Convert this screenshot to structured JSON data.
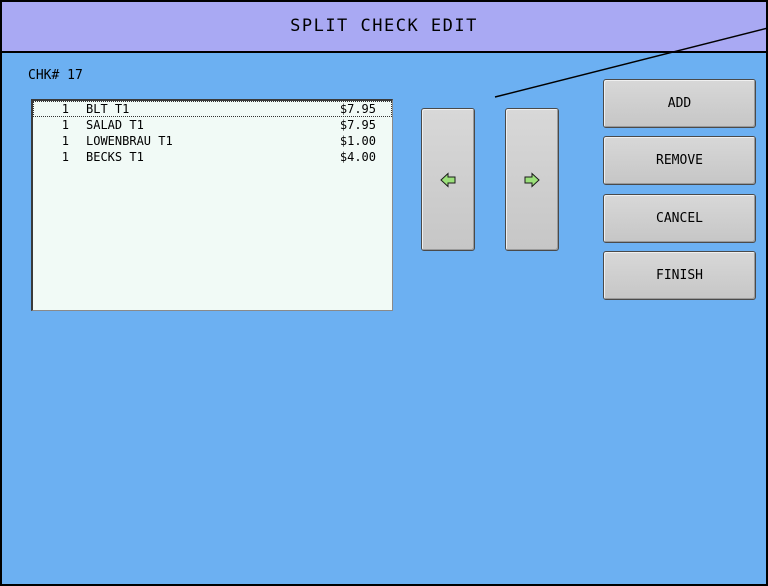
{
  "title": "SPLIT CHECK EDIT",
  "check_label": "CHK# 17",
  "items": [
    {
      "qty": "1",
      "name": "BLT T1",
      "price": "$7.95",
      "selected": true
    },
    {
      "qty": "1",
      "name": "SALAD T1",
      "price": "$7.95",
      "selected": false
    },
    {
      "qty": "1",
      "name": "LOWENBRAU T1",
      "price": "$1.00",
      "selected": false
    },
    {
      "qty": "1",
      "name": "BECKS T1",
      "price": "$4.00",
      "selected": false
    }
  ],
  "arrows": {
    "left_icon": "left-arrow-icon",
    "right_icon": "right-arrow-icon",
    "arrow_color": "#9be07a"
  },
  "buttons": {
    "add": "ADD",
    "remove": "REMOVE",
    "cancel": "CANCEL",
    "finish": "FINISH"
  },
  "colors": {
    "screen_background": "#6cb0f2",
    "title_bar": "#a9a9f3",
    "list_background": "#f1faf6",
    "button_face": "#d0d0d0"
  }
}
